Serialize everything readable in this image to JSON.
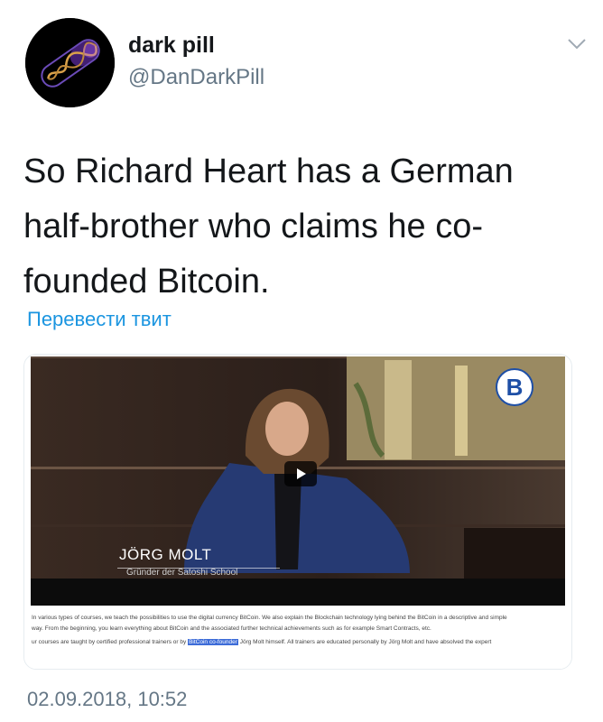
{
  "user": {
    "display_name": "dark pill",
    "handle": "@DanDarkPill"
  },
  "tweet": {
    "text": "So Richard Heart has a German half-brother who claims he co-founded Bitcoin.",
    "translate_label": "Перевести твит",
    "timestamp": "02.09.2018, 10:52"
  },
  "media": {
    "video_name": "JÖRG MOLT",
    "video_subtitle": "Gründer der Satoshi School",
    "caption_line1": "In various types of courses, we teach the possibilities to use the digital currency BitCoin. We also explain the Blockchain technology lying behind the BitCoin in a descriptive and simple",
    "caption_line2": "way. From the beginning, you learn everything about BitCoin and the associated further technical achievements such as for example Smart Contracts, etc.",
    "caption_line3_pre": "ur courses are taught by certified professional trainers or by",
    "caption_highlight": "BitCoin co-founder",
    "caption_line3_post": "Jörg Molt himself. All trainers are educated personally by Jörg Molt and have absolved the expert"
  },
  "icons": {
    "chevron": "chevron-down-icon",
    "play": "play-icon",
    "bitcoin": "bitcoin-logo-icon"
  },
  "colors": {
    "link": "#1b95e0",
    "secondary_text": "#657786",
    "highlight": "#3d6cd8"
  }
}
